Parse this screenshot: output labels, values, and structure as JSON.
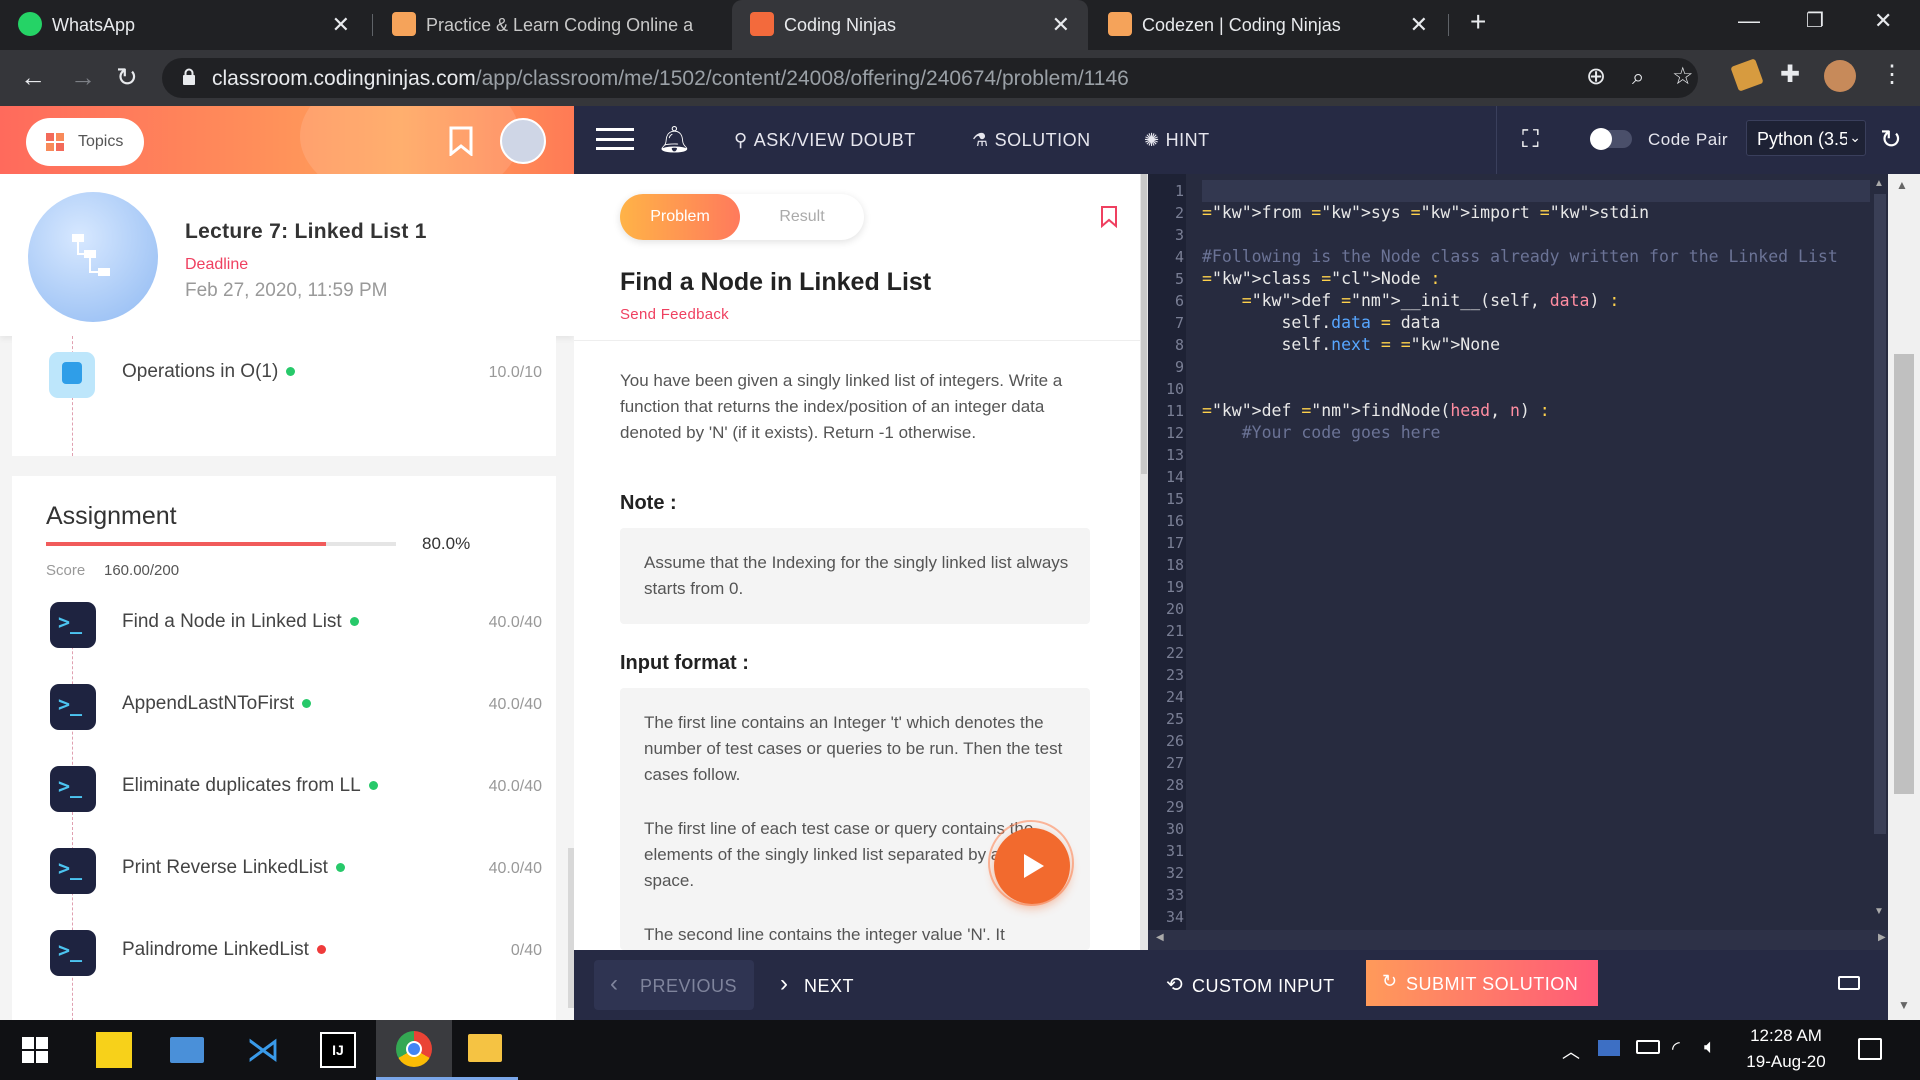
{
  "browser": {
    "tabs": [
      {
        "title": "WhatsApp",
        "active": false
      },
      {
        "title": "Practice & Learn Coding Online a",
        "active": false
      },
      {
        "title": "Coding Ninjas",
        "active": true
      },
      {
        "title": "Codezen | Coding Ninjas",
        "active": false
      }
    ],
    "new_tab_symbol": "+",
    "url_domain": "classroom.codingninjas.com",
    "url_path": "/app/classroom/me/1502/content/24008/offering/240674/problem/1146"
  },
  "sidebar": {
    "topics_label": "Topics",
    "lecture": {
      "title": "Lecture 7: Linked List 1",
      "deadline_label": "Deadline",
      "deadline_value": "Feb 27, 2020, 11:59 PM"
    },
    "prev_item": {
      "label": "Operations in O(1)",
      "score": "10.0/10",
      "status_color": "#27c96a"
    },
    "assignment": {
      "heading": "Assignment",
      "progress_pct": 80.0,
      "progress_text": "80.0%",
      "score_label": "Score",
      "score_value": "160.00/200",
      "items": [
        {
          "label": "Find a Node in Linked List",
          "score": "40.0/40",
          "status_color": "#27c96a",
          "active": true
        },
        {
          "label": "AppendLastNToFirst",
          "score": "40.0/40",
          "status_color": "#27c96a",
          "active": false
        },
        {
          "label": "Eliminate duplicates from LL",
          "score": "40.0/40",
          "status_color": "#27c96a",
          "active": false
        },
        {
          "label": "Print Reverse LinkedList",
          "score": "40.0/40",
          "status_color": "#27c96a",
          "active": false
        },
        {
          "label": "Palindrome LinkedList",
          "score": "0/40",
          "status_color": "#ef3b3b",
          "active": false
        }
      ]
    }
  },
  "toolbar": {
    "doubt_label": "ASK/VIEW DOUBT",
    "solution_label": "SOLUTION",
    "hint_label": "HINT",
    "code_pair_label": "Code Pair",
    "language": "Python (3.5"
  },
  "problem": {
    "tab_problem": "Problem",
    "tab_result": "Result",
    "title": "Find a Node in Linked List",
    "feedback_label": "Send Feedback",
    "description": "You have been given a singly linked list of integers. Write a function that returns the index/position of an integer data denoted by 'N' (if it exists). Return -1 otherwise.",
    "note_heading": "Note :",
    "note_text": "Assume that the Indexing for the singly linked list always starts from 0.",
    "input_heading": "Input format :",
    "input_p1": "The first line contains an Integer 't' which denotes the number of test cases or queries to be run. Then the test cases follow.",
    "input_p2": "The first line of each test case or query contains the elements of the singly linked list separated by a single space.",
    "input_p3": "The second line contains the integer value 'N'. It"
  },
  "editor": {
    "line_count": 34,
    "code_lines": [
      "",
      "from sys import stdin",
      "",
      "#Following is the Node class already written for the Linked List",
      "class Node :",
      "    def __init__(self, data) :",
      "        self.data = data",
      "        self.next = None",
      "",
      "",
      "def findNode(head, n) :",
      "    #Your code goes here"
    ]
  },
  "bottom": {
    "previous_label": "PREVIOUS",
    "next_label": "NEXT",
    "custom_input_label": "CUSTOM INPUT",
    "submit_label": "SUBMIT SOLUTION"
  },
  "taskbar": {
    "time": "12:28 AM",
    "date": "19-Aug-20"
  }
}
